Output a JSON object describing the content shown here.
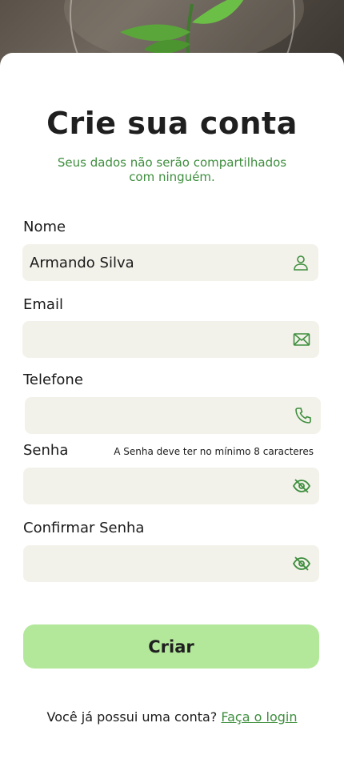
{
  "header": {
    "title": "Crie sua conta",
    "subtitle": "Seus dados não serão compartilhados com ninguém."
  },
  "form": {
    "name": {
      "label": "Nome",
      "value": "Armando Silva",
      "icon": "user-icon"
    },
    "email": {
      "label": "Email",
      "value": "",
      "icon": "mail-icon"
    },
    "phone": {
      "label": "Telefone",
      "value": "",
      "icon": "phone-icon"
    },
    "password": {
      "label": "Senha",
      "hint": "A Senha deve ter no mínimo 8 caracteres",
      "value": "",
      "icon": "eye-off-icon"
    },
    "confirm_password": {
      "label": "Confirmar Senha",
      "value": "",
      "icon": "eye-off-icon"
    },
    "submit_label": "Criar"
  },
  "footer": {
    "question": "Você já possui uma conta?",
    "login_link": "Faça o login"
  },
  "colors": {
    "accent_green": "#3e8e3e",
    "button_green": "#b3e89b",
    "field_bg": "#f3f2ea"
  }
}
